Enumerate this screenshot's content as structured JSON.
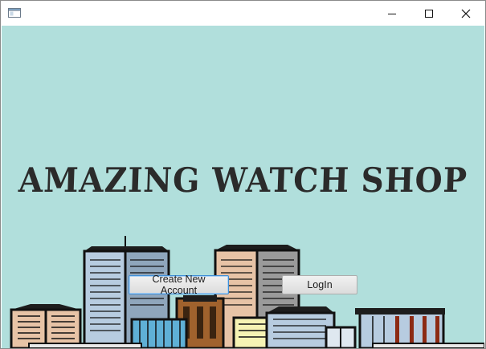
{
  "window": {
    "title": "",
    "controls": {
      "minimize": "minimize",
      "maximize": "maximize",
      "close": "close"
    }
  },
  "main": {
    "title": "AMAZING WATCH SHOP",
    "background_color": "#b1dfdc"
  },
  "buttons": {
    "create_account": "Create New Account",
    "login": "LogIn"
  }
}
